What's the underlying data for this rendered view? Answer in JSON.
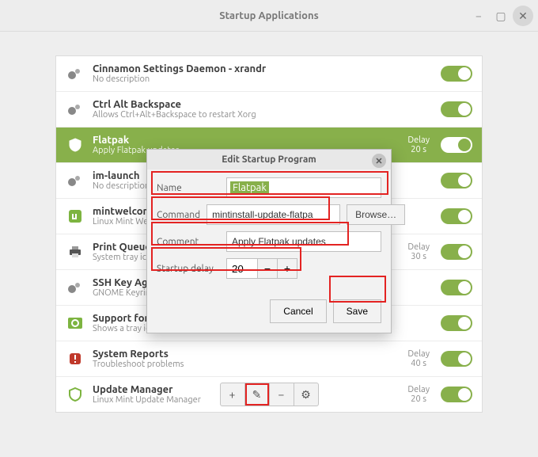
{
  "window": {
    "title": "Startup Applications"
  },
  "apps": [
    {
      "title": "Cinnamon Settings Daemon - xrandr",
      "desc": "No description",
      "delay": ""
    },
    {
      "title": "Ctrl Alt Backspace",
      "desc": "Allows Ctrl+Alt+Backspace to restart Xorg",
      "delay": ""
    },
    {
      "title": "Flatpak",
      "desc": "Apply Flatpak updates",
      "delay_label": "Delay",
      "delay_value": "20 s"
    },
    {
      "title": "im-launch",
      "desc": "No description",
      "delay": ""
    },
    {
      "title": "mintwelcome",
      "desc": "Linux Mint Welcome Screen",
      "delay": ""
    },
    {
      "title": "Print Queue Applet",
      "desc": "System tray icon for managing print jobs",
      "delay_label": "Delay",
      "delay_value": "30 s"
    },
    {
      "title": "SSH Key Agent",
      "desc": "GNOME Keyring: SSH Agent",
      "delay": ""
    },
    {
      "title": "Support for NVIDIA Prime",
      "desc": "Shows a tray icon when a compatible NVIDIA Optimus graph…",
      "delay": ""
    },
    {
      "title": "System Reports",
      "desc": "Troubleshoot problems",
      "delay_label": "Delay",
      "delay_value": "40 s"
    },
    {
      "title": "Update Manager",
      "desc": "Linux Mint Update Manager",
      "delay_label": "Delay",
      "delay_value": "20 s"
    }
  ],
  "dialog": {
    "title": "Edit Startup Program",
    "name_label": "Name",
    "name_value": "Flatpak",
    "command_label": "Command",
    "command_value": "mintinstall-update-flatpa",
    "browse_label": "Browse…",
    "comment_label": "Comment",
    "comment_value": "Apply Flatpak updates",
    "delay_label": "Startup delay",
    "delay_value": "20",
    "cancel_label": "Cancel",
    "save_label": "Save"
  },
  "toolbar": {
    "add": "+",
    "edit": "✎",
    "remove": "−",
    "run": "⚙"
  }
}
